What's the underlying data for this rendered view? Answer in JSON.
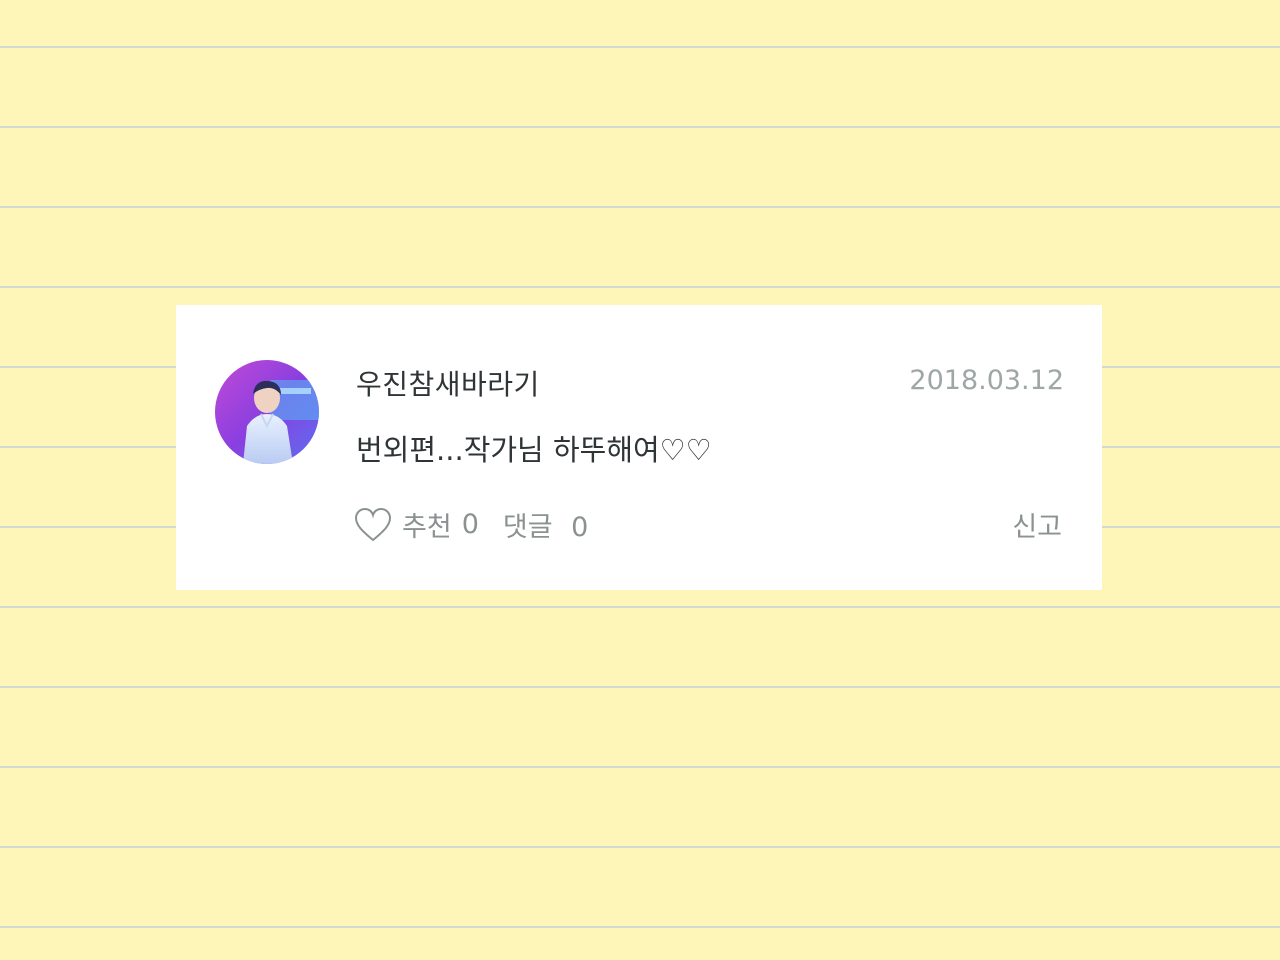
{
  "comment": {
    "username": "우진참새바라기",
    "date": "2018.03.12",
    "text": "번외편...작가님 하뚜해여♡♡",
    "like": {
      "label": "추천",
      "count": "0",
      "icon": "heart-outline-icon"
    },
    "reply": {
      "label": "댓글",
      "count": "0"
    },
    "report_label": "신고"
  },
  "colors": {
    "background": "#fdf6b8",
    "rule_line": "#d3d8d0",
    "card": "#ffffff",
    "text_primary": "#2f3437",
    "text_secondary": "#8b9191"
  }
}
